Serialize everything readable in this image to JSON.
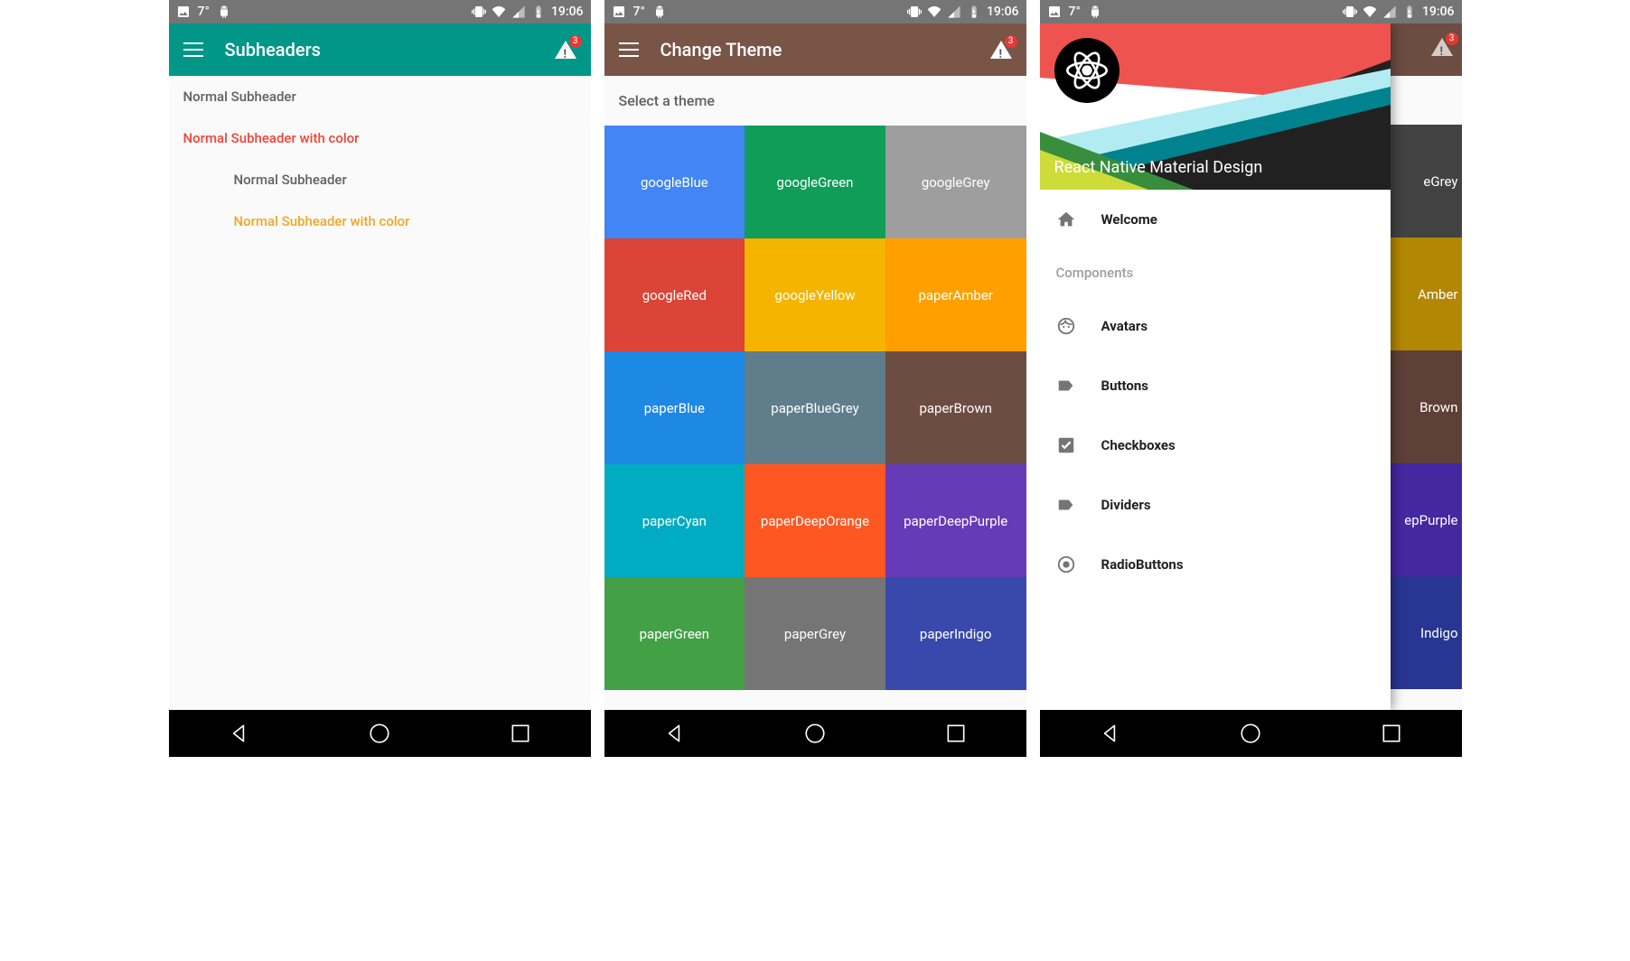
{
  "statusbar": {
    "temp": "7°",
    "time": "19:06"
  },
  "screen1": {
    "appbar": {
      "title": "Subheaders",
      "badge": "3",
      "appbar_bg": "#009688"
    },
    "subheaders": [
      {
        "text": "Normal Subheader",
        "color": "#616161",
        "indent": false
      },
      {
        "text": "Normal Subheader with color",
        "color": "#f44336",
        "indent": false
      },
      {
        "text": "Normal Subheader",
        "color": "#616161",
        "indent": true
      },
      {
        "text": "Normal Subheader with color",
        "color": "#f5a623",
        "indent": true
      }
    ]
  },
  "screen2": {
    "appbar": {
      "title": "Change Theme",
      "badge": "3",
      "appbar_bg": "#795548"
    },
    "select_label": "Select a theme",
    "themes": [
      {
        "name": "googleBlue",
        "bg": "#4285f4"
      },
      {
        "name": "googleGreen",
        "bg": "#0f9d58"
      },
      {
        "name": "googleGrey",
        "bg": "#9e9e9e"
      },
      {
        "name": "googleRed",
        "bg": "#db4437"
      },
      {
        "name": "googleYellow",
        "bg": "#f4b400"
      },
      {
        "name": "paperAmber",
        "bg": "#ffa000"
      },
      {
        "name": "paperBlue",
        "bg": "#1e88e5"
      },
      {
        "name": "paperBlueGrey",
        "bg": "#607d8b"
      },
      {
        "name": "paperBrown",
        "bg": "#6d4c41"
      },
      {
        "name": "paperCyan",
        "bg": "#00acc1"
      },
      {
        "name": "paperDeepOrange",
        "bg": "#ff5722"
      },
      {
        "name": "paperDeepPurple",
        "bg": "#673ab7"
      },
      {
        "name": "paperGreen",
        "bg": "#43a047"
      },
      {
        "name": "paperGrey",
        "bg": "#757575"
      },
      {
        "name": "paperIndigo",
        "bg": "#3949ab"
      }
    ]
  },
  "screen3": {
    "drawer_title": "React Native Material Design",
    "items": [
      {
        "icon": "home-icon",
        "label": "Welcome",
        "type": "item"
      },
      {
        "label": "Components",
        "type": "subheader"
      },
      {
        "icon": "face-icon",
        "label": "Avatars",
        "type": "item"
      },
      {
        "icon": "label-icon",
        "label": "Buttons",
        "type": "item"
      },
      {
        "icon": "checkbox-icon",
        "label": "Checkboxes",
        "type": "item"
      },
      {
        "icon": "label-icon",
        "label": "Dividers",
        "type": "item"
      },
      {
        "icon": "radio-icon",
        "label": "RadioButtons",
        "type": "item"
      }
    ],
    "behind": {
      "badge": "3",
      "rows": [
        {
          "text": "eGrey",
          "bg": "#424242"
        },
        {
          "text": "Amber",
          "bg": "#b28704"
        },
        {
          "text": "Brown",
          "bg": "#5d4037"
        },
        {
          "text": "epPurple",
          "bg": "#4527a0"
        },
        {
          "text": "Indigo",
          "bg": "#283593"
        }
      ]
    }
  }
}
